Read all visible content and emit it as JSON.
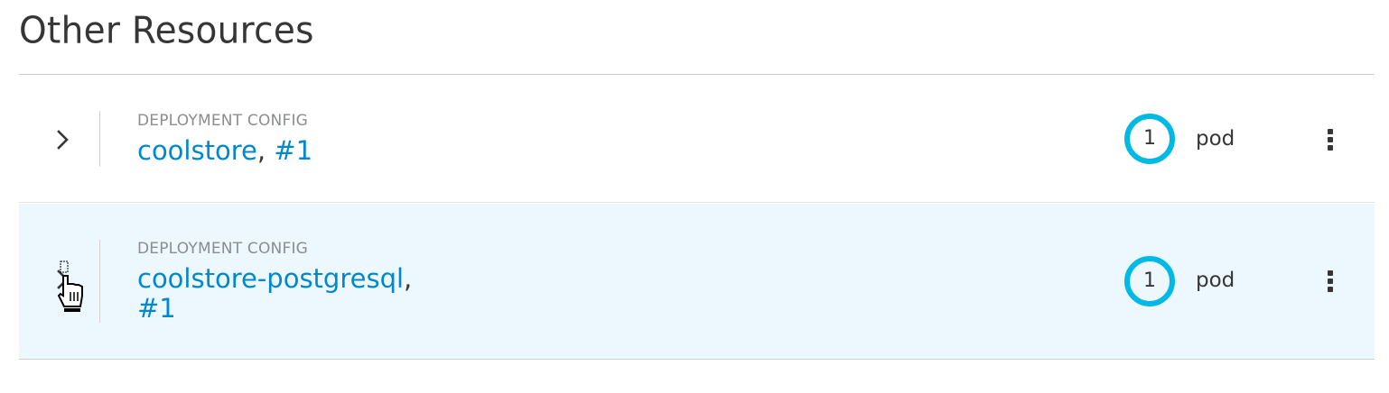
{
  "section": {
    "title": "Other Resources"
  },
  "resources": [
    {
      "kind": "DEPLOYMENT CONFIG",
      "name": "coolstore",
      "separator": ",",
      "revision": "#1",
      "pod_count": "1",
      "pod_label": "pod",
      "expanded": false,
      "toggle_icon": "chevron-right-icon",
      "menu_icon": "kebab-menu-icon"
    },
    {
      "kind": "DEPLOYMENT CONFIG",
      "name": "coolstore-postgresql",
      "separator": ",",
      "revision": "#1",
      "pod_count": "1",
      "pod_label": "pod",
      "hovered": true,
      "toggle_icon": "chevron-right-icon",
      "menu_icon": "kebab-menu-icon"
    }
  ],
  "colors": {
    "link": "#0088ce",
    "donut": "#00b9e4",
    "hover_row": "#edf8fe",
    "text": "#363636",
    "muted": "#8b8d8f"
  }
}
